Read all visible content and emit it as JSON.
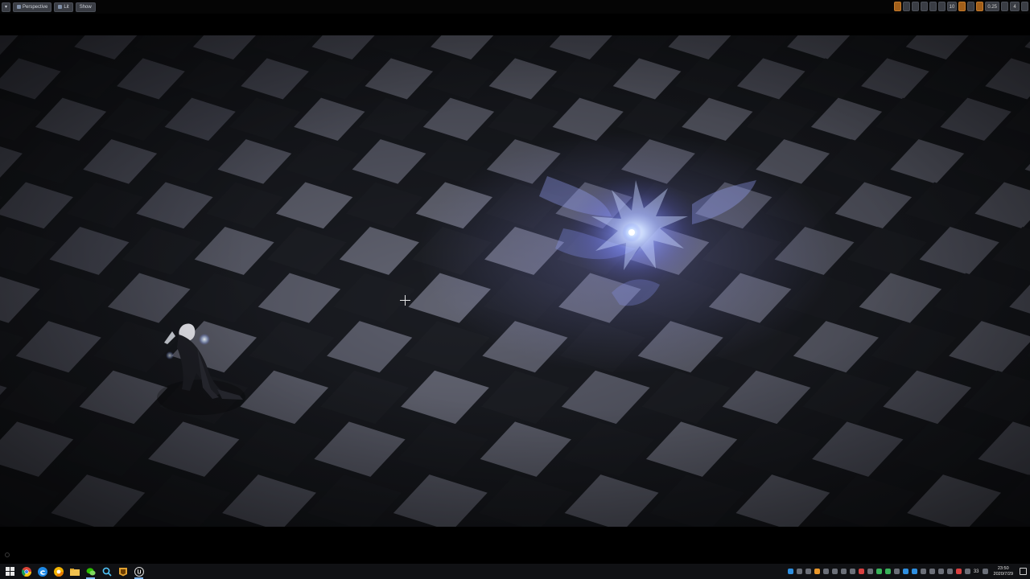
{
  "toolbar": {
    "perspective_label": "Perspective",
    "lit_label": "Lit",
    "show_label": "Show",
    "grid_snap_value": "10",
    "camera_speed_value": "0.25",
    "camera_count_value": "4"
  },
  "taskbar": {
    "apps": [
      "windows-start-icon",
      "chrome-icon",
      "edge-icon",
      "chrome-dev-icon",
      "wechat-icon",
      "search-app-icon",
      "file-explorer-icon",
      "epic-launcher-icon",
      "unreal-engine-icon"
    ],
    "clock_time": "23:50",
    "clock_date": "2020/7/29",
    "tray_number": "33"
  }
}
